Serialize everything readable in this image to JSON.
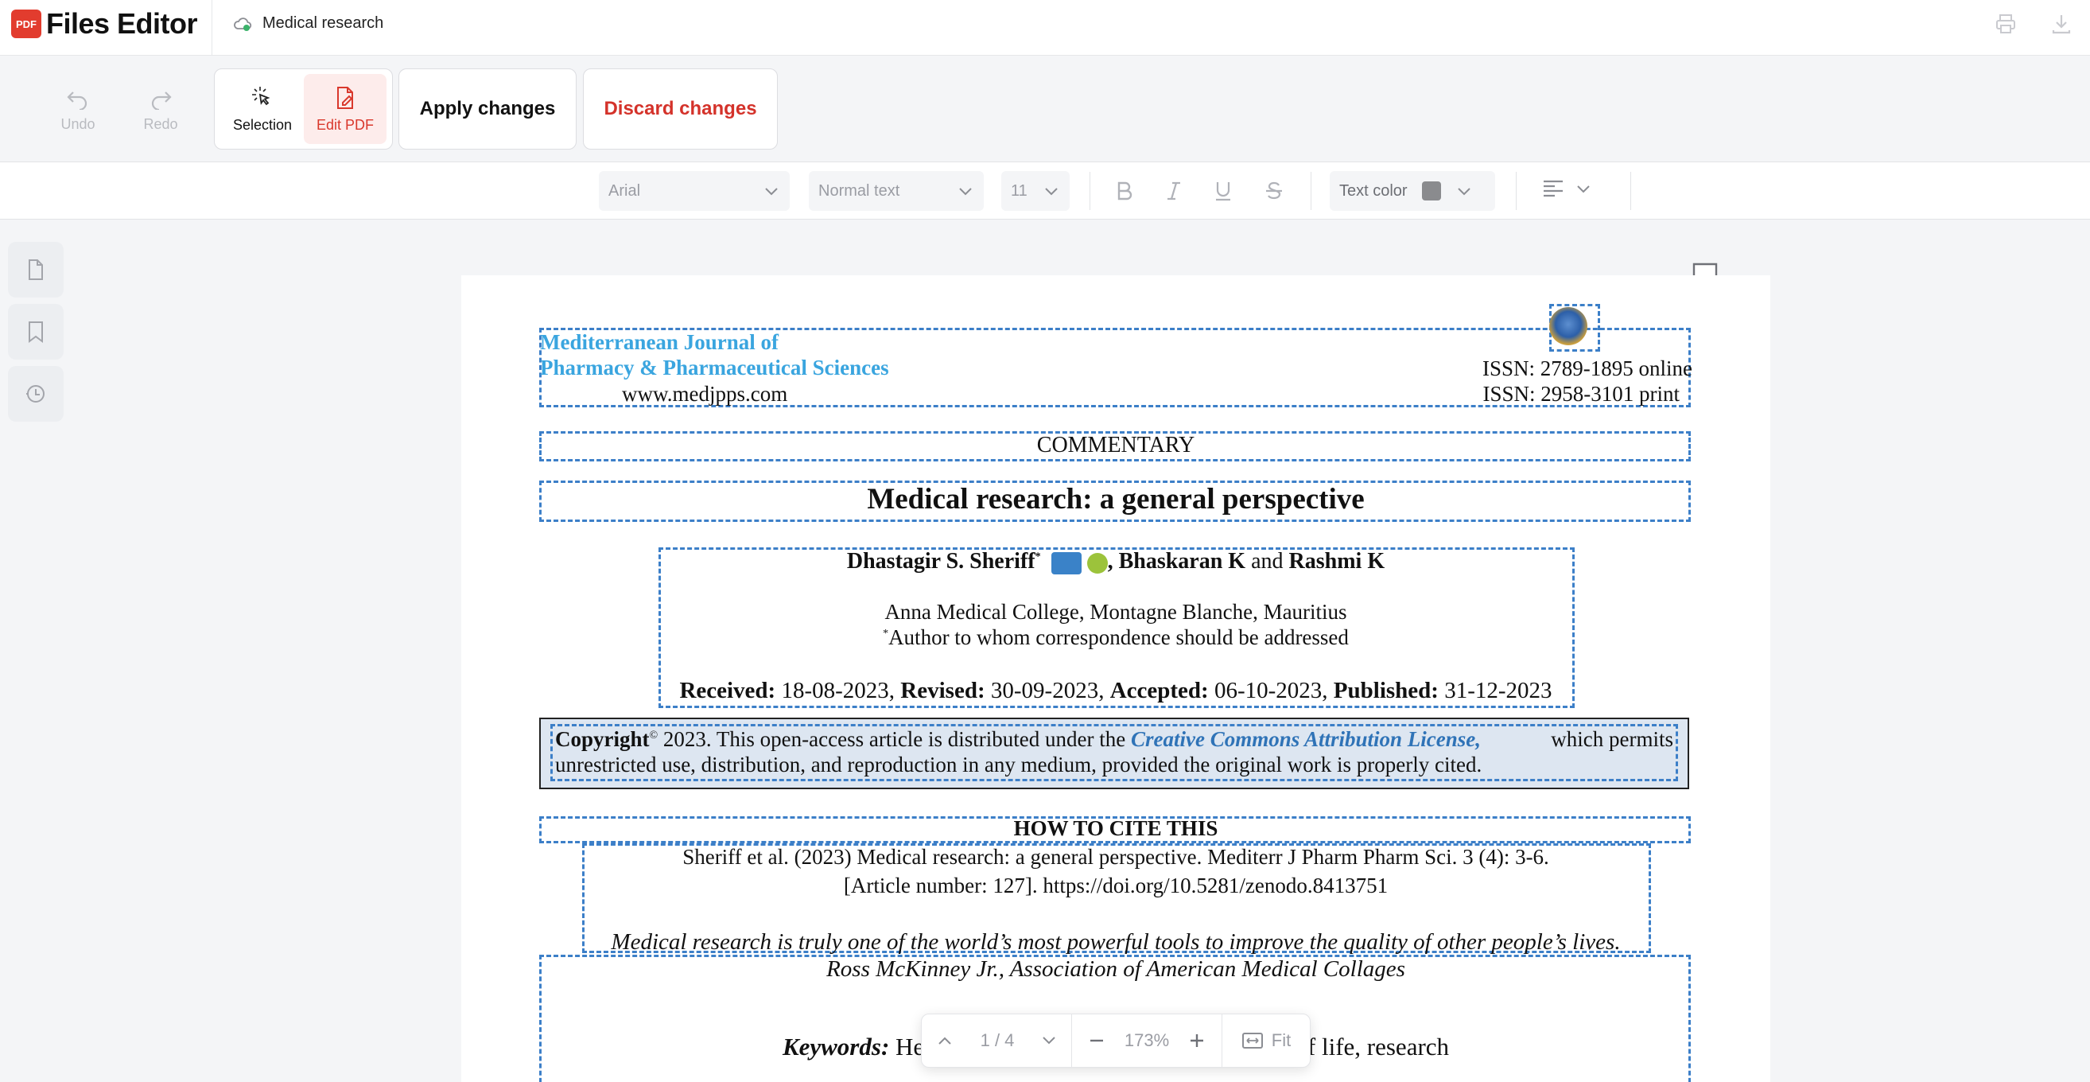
{
  "app": {
    "title": "Files Editor",
    "logo_badge": "PDF"
  },
  "document": {
    "name": "Medical research"
  },
  "toolbar": {
    "undo_label": "Undo",
    "redo_label": "Redo",
    "selection_label": "Selection",
    "edit_pdf_label": "Edit PDF",
    "apply_label": "Apply changes",
    "discard_label": "Discard changes"
  },
  "format": {
    "font": "Arial",
    "style": "Normal text",
    "size": "11",
    "text_color_label": "Text color",
    "text_color": "#8a8b8e"
  },
  "page": {
    "journal_line1": "Mediterranean Journal of",
    "journal_line2": "Pharmacy & Pharmaceutical Sciences",
    "website": "www.medjpps.com",
    "issn_online": "ISSN: 2789-1895 online",
    "issn_print": "ISSN: 2958-3101 print",
    "section": "COMMENTARY",
    "title": "Medical research: a general perspective",
    "author1": "Dhastagir S. Sheriff",
    "author_sep1": ", Bhaskaran K",
    "author_and": " and ",
    "author3": "Rashmi K",
    "affiliation_college": "Anna Medical College,",
    "affiliation_place": " Montagne Blanche, Mauritius",
    "correspondence": "Author to whom correspondence should be addressed",
    "received_label": "Received:",
    "received": " 18-08-2023, ",
    "revised_label": "Revised:",
    "revised": " 30-09-2023, ",
    "accepted_label": "Accepted:",
    "accepted": " 06-10-2023, ",
    "published_label": "Published:",
    "published": " 31-12-2023",
    "copyright_label": "Copyright",
    "copyright_text": " 2023. This open-access article is distributed under the ",
    "license": "Creative Commons Attribution License,",
    "copyright_tail": "which permits",
    "copyright_line2": "unrestricted use, distribution, and reproduction in any medium, provided the original work is properly cited.",
    "how_to_cite": "HOW TO CITE THIS",
    "citation_line1": "Sheriff et al. (2023) Medical research: a general perspective. Mediterr J Pharm Pharm Sci. 3 (4): 3-6.",
    "citation_line2": "[Article number: 127]. https://doi.org/10.5281/zenodo.8413751",
    "quote": "Medical research is truly one of the world’s most powerful tools to improve the quality of other people’s lives.",
    "quote_author": "Ross McKinney Jr., Association of American Medical Collages",
    "keywords_label": "Keywords:",
    "keywords_start": " Healt",
    "keywords_end": "y of life, research"
  },
  "zoom": {
    "page_indicator": "1 / 4",
    "zoom_level": "173%",
    "fit_label": "Fit"
  }
}
